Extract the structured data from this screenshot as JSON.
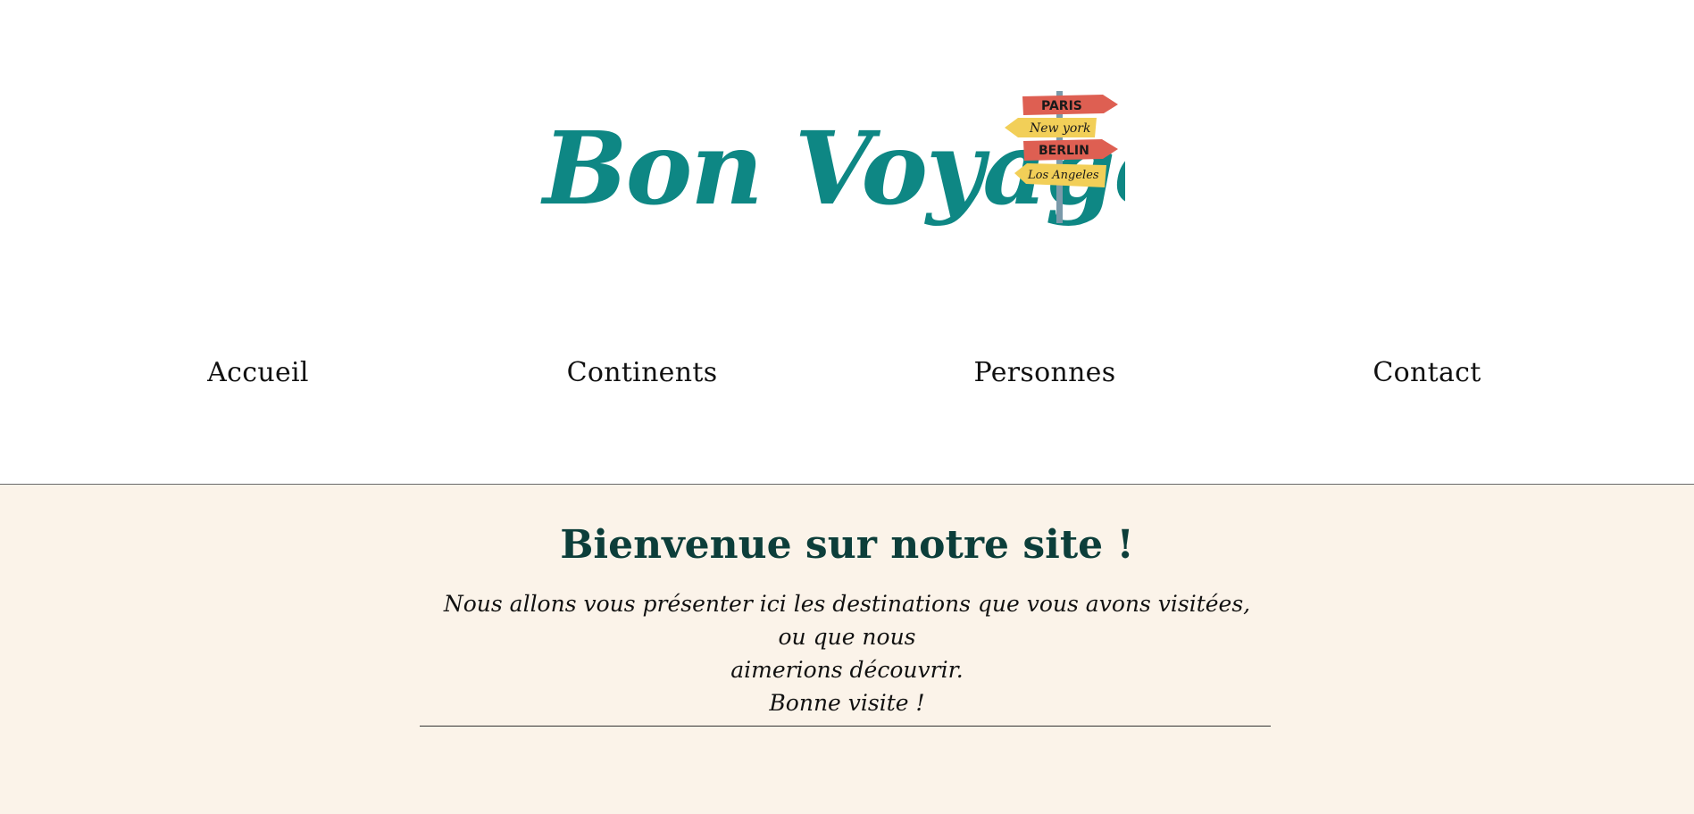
{
  "brand": {
    "logo_text": "Bon Voyage",
    "signpost": [
      "PARIS",
      "New york",
      "BERLIN",
      "Los Angeles"
    ],
    "colors": {
      "logo_teal": "#0e8784",
      "sign_red": "#de5f52",
      "sign_yellow": "#f2cf58",
      "post": "#7a9aaa"
    }
  },
  "nav": {
    "items": [
      {
        "label": "Accueil"
      },
      {
        "label": "Continents"
      },
      {
        "label": "Personnes"
      },
      {
        "label": "Contact"
      }
    ]
  },
  "main": {
    "title": "Bienvenue sur notre site !",
    "intro_line1": "Nous allons vous présenter ici les destinations que vous avons visitées, ou que nous",
    "intro_line2": "aimerions découvrir.",
    "intro_line3": "Bonne visite !",
    "colors": {
      "background": "#fbf3e9",
      "title": "#0c3e3a"
    }
  }
}
